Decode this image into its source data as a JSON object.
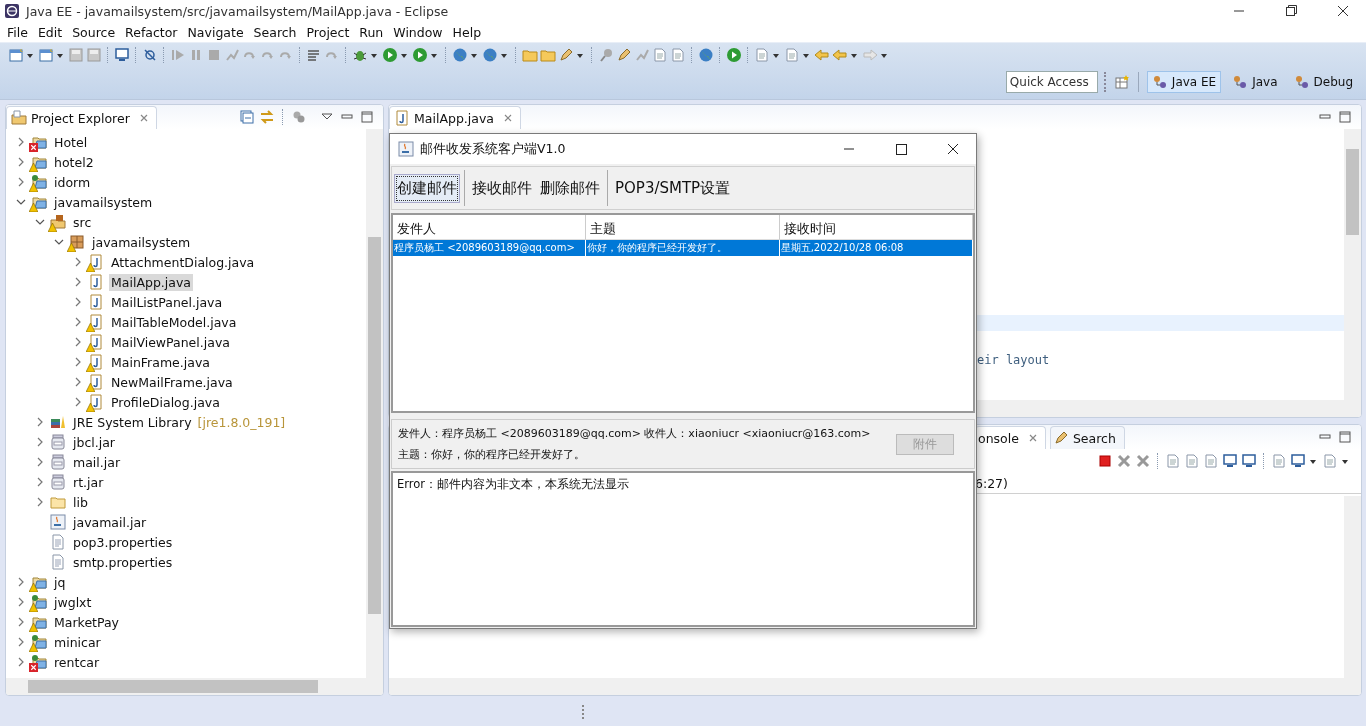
{
  "window": {
    "title": "Java EE - javamailsystem/src/javamailsystem/MailApp.java - Eclipse"
  },
  "menu": [
    "File",
    "Edit",
    "Source",
    "Refactor",
    "Navigate",
    "Search",
    "Project",
    "Run",
    "Window",
    "Help"
  ],
  "quick_access": {
    "placeholder": "Quick Access"
  },
  "perspectives": [
    {
      "label": "Java EE",
      "selected": true
    },
    {
      "label": "Java",
      "selected": false
    },
    {
      "label": "Debug",
      "selected": false
    }
  ],
  "project_explorer": {
    "title": "Project Explorer",
    "items": [
      {
        "label": "Hotel",
        "kind": "project",
        "warning": false,
        "error": true,
        "expanded": false
      },
      {
        "label": "hotel2",
        "kind": "project",
        "warning": true,
        "error": false,
        "expanded": false
      },
      {
        "label": "idorm",
        "kind": "web-project",
        "warning": true,
        "error": false,
        "expanded": false
      },
      {
        "label": "javamailsystem",
        "kind": "project",
        "warning": true,
        "error": false,
        "expanded": true,
        "children": [
          {
            "label": "src",
            "kind": "source-folder",
            "warning": true,
            "error": false,
            "expanded": true,
            "children": [
              {
                "label": "javamailsystem",
                "kind": "package",
                "warning": true,
                "error": false,
                "expanded": true,
                "children": [
                  {
                    "label": "AttachmentDialog.java",
                    "kind": "java",
                    "warning": true,
                    "error": false,
                    "expanded": false,
                    "selected": false
                  },
                  {
                    "label": "MailApp.java",
                    "kind": "java",
                    "warning": false,
                    "error": false,
                    "expanded": false,
                    "selected": true
                  },
                  {
                    "label": "MailListPanel.java",
                    "kind": "java",
                    "warning": false,
                    "error": false,
                    "expanded": false,
                    "selected": false
                  },
                  {
                    "label": "MailTableModel.java",
                    "kind": "java",
                    "warning": true,
                    "error": false,
                    "expanded": false,
                    "selected": false
                  },
                  {
                    "label": "MailViewPanel.java",
                    "kind": "java",
                    "warning": true,
                    "error": false,
                    "expanded": false,
                    "selected": false
                  },
                  {
                    "label": "MainFrame.java",
                    "kind": "java",
                    "warning": true,
                    "error": false,
                    "expanded": false,
                    "selected": false
                  },
                  {
                    "label": "NewMailFrame.java",
                    "kind": "java",
                    "warning": true,
                    "error": false,
                    "expanded": false,
                    "selected": false
                  },
                  {
                    "label": "ProfileDialog.java",
                    "kind": "java",
                    "warning": true,
                    "error": false,
                    "expanded": false,
                    "selected": false
                  }
                ]
              }
            ]
          },
          {
            "label": "JRE System Library",
            "detail": "[jre1.8.0_191]",
            "kind": "library",
            "warning": false,
            "error": false,
            "expanded": false
          },
          {
            "label": "jbcl.jar",
            "kind": "jar",
            "warning": false,
            "error": false,
            "expanded": false
          },
          {
            "label": "mail.jar",
            "kind": "jar",
            "warning": false,
            "error": false,
            "expanded": false
          },
          {
            "label": "rt.jar",
            "kind": "jar",
            "warning": false,
            "error": false,
            "expanded": false
          },
          {
            "label": "lib",
            "kind": "folder",
            "warning": false,
            "error": false,
            "expanded": false
          },
          {
            "label": "javamail.jar",
            "kind": "java-archive",
            "warning": false,
            "error": false
          },
          {
            "label": "pop3.properties",
            "kind": "text-file",
            "warning": false,
            "error": false
          },
          {
            "label": "smtp.properties",
            "kind": "text-file",
            "warning": false,
            "error": false
          }
        ]
      },
      {
        "label": "jq",
        "kind": "project",
        "warning": true,
        "error": false,
        "expanded": false
      },
      {
        "label": "jwglxt",
        "kind": "web-project",
        "warning": true,
        "error": false,
        "expanded": false
      },
      {
        "label": "MarketPay",
        "kind": "project",
        "warning": true,
        "error": false,
        "expanded": false
      },
      {
        "label": "minicar",
        "kind": "web-project",
        "warning": true,
        "error": false,
        "expanded": false
      },
      {
        "label": "rentcar",
        "kind": "web-project",
        "warning": false,
        "error": true,
        "expanded": false
      }
    ]
  },
  "editor": {
    "tab": "MailApp.java",
    "visible_code": "eir layout"
  },
  "console": {
    "tabs": [
      {
        "label": "onsole",
        "selected": true
      },
      {
        "label": "Search",
        "selected": false
      }
    ],
    "text": "6:27)"
  },
  "dialog": {
    "title": "邮件收发系统客户端V1.0",
    "toolbar_groups": [
      [
        {
          "label": "创建邮件",
          "focused": true
        }
      ],
      [
        {
          "label": "接收邮件",
          "focused": false
        },
        {
          "label": "删除邮件",
          "focused": false
        }
      ],
      [
        {
          "label": "POP3/SMTP设置",
          "focused": false
        }
      ]
    ],
    "columns": [
      "发件人",
      "主题",
      "接收时间"
    ],
    "rows": [
      {
        "cells": [
          "程序员杨工 <2089603189@qq.com>",
          "你好，你的程序已经开发好了。",
          "星期五,2022/10/28 06:08"
        ],
        "selected": true
      }
    ],
    "header_lines": [
      "发件人：程序员杨工 <2089603189@qq.com>  收件人：xiaoniucr <xiaoniucr@163.com>",
      "主题：你好，你的程序已经开发好了。"
    ],
    "attachment_button": {
      "label": "附件",
      "disabled": true
    },
    "body": "Error：邮件内容为非文本，本系统无法显示"
  }
}
